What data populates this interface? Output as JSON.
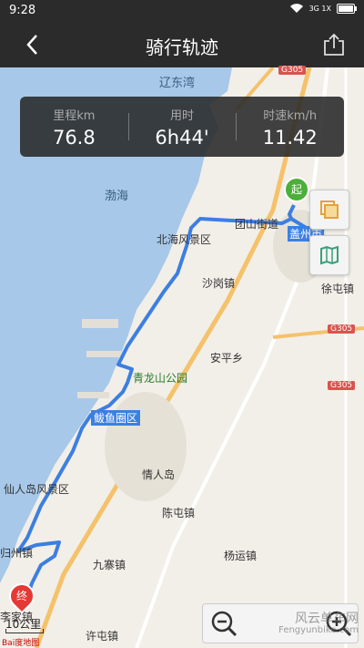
{
  "status": {
    "time": "9:28",
    "signal": "3G 1X"
  },
  "header": {
    "title": "骑行轨迹"
  },
  "stats": [
    {
      "label": "里程km",
      "value": "76.8"
    },
    {
      "label": "用时",
      "value": "6h44'"
    },
    {
      "label": "时速km/h",
      "value": "11.42"
    }
  ],
  "map": {
    "labels": {
      "liaodong": "辽东湾",
      "bohai": "渤海",
      "tuanshan": "团山街道",
      "gaizhou": "盖州市",
      "beihai": "北海风景区",
      "shagang": "沙岗镇",
      "xutun": "徐屯镇",
      "anping": "安平乡",
      "qinglongshan": "青龙山公园",
      "bayuquan": "鲅鱼圈区",
      "qingrendao": "情人岛",
      "xianrendao": "仙人岛风景区",
      "chentun": "陈屯镇",
      "guizhou": "归州镇",
      "yangyun": "杨运镇",
      "jiuzhai": "九寨镇",
      "xuguang": "许屯镇",
      "lishan": "李家镇"
    },
    "roads": {
      "g305a": "G305",
      "g305b": "G305",
      "g305c": "G305"
    },
    "start_marker": "起",
    "end_marker": "终",
    "scale": "10公里",
    "baidu": "Bai度地图",
    "route_color": "#3d7fe0"
  },
  "watermark": {
    "line1": "风云单车网",
    "line2": "Fengyunbike.com"
  }
}
